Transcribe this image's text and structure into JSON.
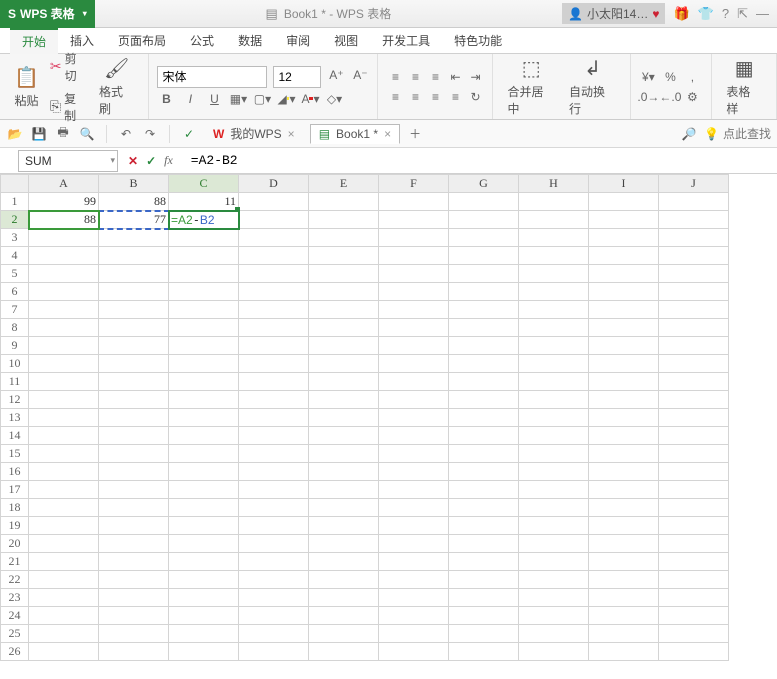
{
  "app": {
    "name": "WPS 表格",
    "doc_title": "Book1 * - WPS 表格"
  },
  "user": {
    "name": "小太阳14…"
  },
  "tabs": [
    "开始",
    "插入",
    "页面布局",
    "公式",
    "数据",
    "审阅",
    "视图",
    "开发工具",
    "特色功能"
  ],
  "active_tab": "开始",
  "ribbon": {
    "paste": "粘贴",
    "cut": "剪切",
    "copy": "复制",
    "format_painter": "格式刷",
    "font_name": "宋体",
    "font_size": "12",
    "merge_center": "合并居中",
    "wrap_text": "自动换行",
    "table_style": "表格样"
  },
  "doc_tabs": {
    "wps_tab": "我的WPS",
    "book_tab": "Book1 *"
  },
  "hint": "点此查找",
  "formula_bar": {
    "name_box": "SUM",
    "formula": "=A2-B2"
  },
  "grid": {
    "cols": [
      "A",
      "B",
      "C",
      "D",
      "E",
      "F",
      "G",
      "H",
      "I",
      "J"
    ],
    "rows": 26,
    "cells": {
      "A1": "99",
      "B1": "88",
      "C1": "11",
      "A2": "88",
      "B2": "77"
    },
    "editing_cell": "C2",
    "editing_parts": {
      "a": "=A2",
      "op": "-",
      "b": "B2"
    },
    "active_col": "C",
    "active_row": 2
  }
}
